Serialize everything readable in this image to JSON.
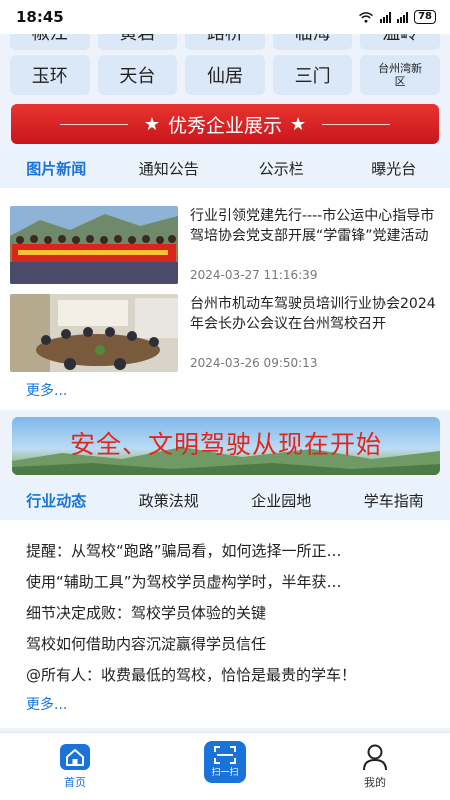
{
  "status": {
    "time": "18:45",
    "battery": "78"
  },
  "cities_top": [
    "椒江",
    "黄岩",
    "路桥",
    "临海",
    "温岭"
  ],
  "cities": [
    "玉环",
    "天台",
    "仙居",
    "三门",
    "台州湾新区"
  ],
  "banner_red": {
    "title": "优秀企业展示"
  },
  "news_tabs": [
    "图片新闻",
    "通知公告",
    "公示栏",
    "曝光台"
  ],
  "news": [
    {
      "title": "行业引领党建先行----市公运中心指导市驾培协会党支部开展“学雷锋”党建活动",
      "date": "2024-03-27 11:16:39"
    },
    {
      "title": "台州市机动车驾驶员培训行业协会2024年会长办公会议在台州驾校召开",
      "date": "2024-03-26 09:50:13"
    }
  ],
  "more_label": "更多...",
  "banner_blue": {
    "text": "安全、文明驾驶从现在开始"
  },
  "industry_tabs": [
    "行业动态",
    "政策法规",
    "企业园地",
    "学车指南"
  ],
  "industry_list": [
    "提醒：从驾校“跑路”骗局看，如何选择一所正…",
    "使用“辅助工具”为驾校学员虚构学时，半年获…",
    "细节决定成败：驾校学员体验的关键",
    "驾校如何借助内容沉淀赢得学员信任",
    "@所有人：收费最低的驾校，恰恰是最贵的学车！"
  ],
  "bottom_nav": {
    "home": "首页",
    "scan": "扫一扫",
    "mine": "我的"
  },
  "colors": {
    "accent": "#1a73d8",
    "banner_red": "#d62028",
    "tab_bg": "#eaf2fc"
  }
}
